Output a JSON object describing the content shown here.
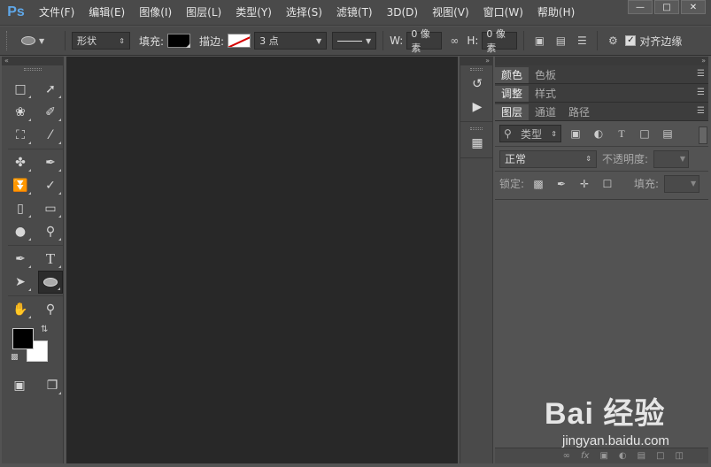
{
  "app": {
    "logo": "Ps"
  },
  "menu": [
    "文件(F)",
    "编辑(E)",
    "图像(I)",
    "图层(L)",
    "类型(Y)",
    "选择(S)",
    "滤镜(T)",
    "3D(D)",
    "视图(V)",
    "窗口(W)",
    "帮助(H)"
  ],
  "options": {
    "mode_select": "形状",
    "fill_label": "填充:",
    "stroke_label": "描边:",
    "stroke_width": "3 点",
    "w_label": "W:",
    "w_value": "0 像素",
    "h_label": "H:",
    "h_value": "0 像素",
    "align_edges_label": "对齐边缘",
    "align_edges_checked": true
  },
  "panels": {
    "row1_tabs": [
      "颜色",
      "色板"
    ],
    "row2_tabs": [
      "调整",
      "样式"
    ],
    "row3_tabs": [
      "图层",
      "通道",
      "路径"
    ],
    "filter_kind": "类型",
    "blend_mode": "正常",
    "opacity_label": "不透明度:",
    "lock_label": "锁定:",
    "fill_label": "填充:"
  },
  "colors": {
    "foreground": "#000000",
    "background": "#ffffff",
    "canvas": "#282828"
  },
  "watermark": {
    "brand": "Bai  经验",
    "url": "jingyan.baidu.com"
  }
}
